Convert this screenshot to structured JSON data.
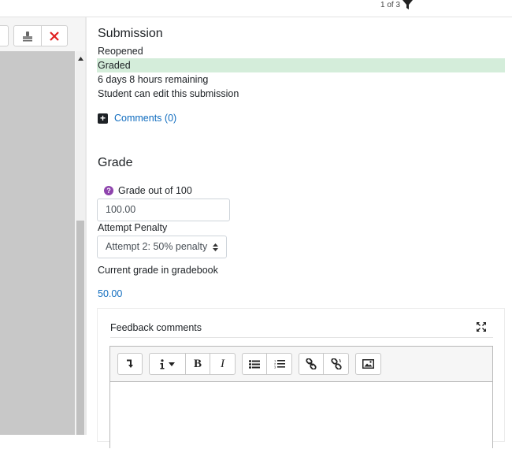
{
  "header": {
    "pager_text": "1 of 3",
    "filter_icon": "filter-icon"
  },
  "left_toolbar": {
    "stamp_icon": "stamp-icon",
    "delete_icon": "close-icon"
  },
  "submission": {
    "heading": "Submission",
    "status_lines": [
      "Reopened",
      "Graded",
      "6 days 8 hours remaining",
      "Student can edit this submission"
    ],
    "comments_link": "Comments (0)"
  },
  "grade": {
    "heading": "Grade",
    "grade_label": "Grade out of 100",
    "grade_value": "100.00",
    "penalty_label": "Attempt Penalty",
    "penalty_selected": "Attempt 2: 50% penalty",
    "current_label": "Current grade in gradebook",
    "current_value": "50.00"
  },
  "feedback": {
    "title": "Feedback comments",
    "toolbar_icons": [
      "expand-toolbar-icon",
      "info-icon",
      "bold-icon",
      "italic-icon",
      "unordered-list-icon",
      "ordered-list-icon",
      "link-icon",
      "unlink-icon",
      "image-icon"
    ],
    "bold_label": "B",
    "italic_label": "I"
  },
  "colors": {
    "graded_bg": "#d4edda",
    "link": "#0f6cbf",
    "help": "#8e44ad"
  }
}
